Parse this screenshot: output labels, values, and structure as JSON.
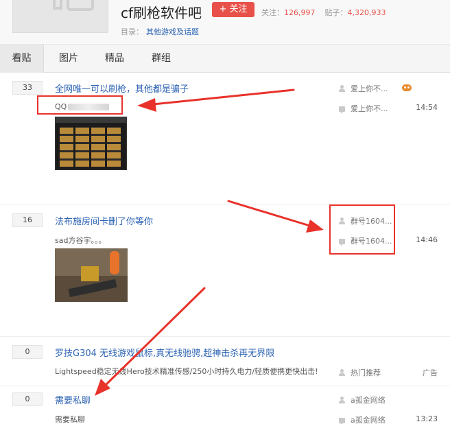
{
  "forum": {
    "name": "cf刷枪软件吧",
    "follow_label": "+ 关注",
    "follow_count_label": "关注：",
    "follow_count": "126,997",
    "post_count_label": "贴子：",
    "post_count": "4,320,933",
    "catalog_label": "目录：",
    "catalog_link": "其他游戏及话题"
  },
  "tabs": [
    "看贴",
    "图片",
    "精品",
    "群组"
  ],
  "threads": [
    {
      "reply_count": "33",
      "title": "全网唯一可以刷枪，其他都是骗子",
      "abstract": "QQ",
      "author": "爱上你不...",
      "last_reply": "爱上你不...",
      "time": "14:54"
    },
    {
      "reply_count": "16",
      "title": "法布施房间卡删了你等你",
      "abstract": "sad方谷宇。。。",
      "author": "群号1604...",
      "last_reply": "群号1604...",
      "time": "14:46"
    },
    {
      "reply_count": "0",
      "title": "罗技G304 无线游戏鼠标,真无线驰骋,超神击杀再无界限",
      "abstract": "Lightspeed稳定无线Hero技术精准传感/250小时持久电力/轻质便携更快出击!",
      "author": "热门推荐",
      "tag": "广告"
    },
    {
      "reply_count": "0",
      "title": "需要私聊",
      "abstract": "需要私聊",
      "author": "a孤金网络",
      "last_reply": "a孤金网络",
      "time": "13:23"
    }
  ],
  "colors": {
    "accent_red": "#e85149",
    "link_blue": "#2d64b3",
    "annotation_red": "#e8322a"
  }
}
